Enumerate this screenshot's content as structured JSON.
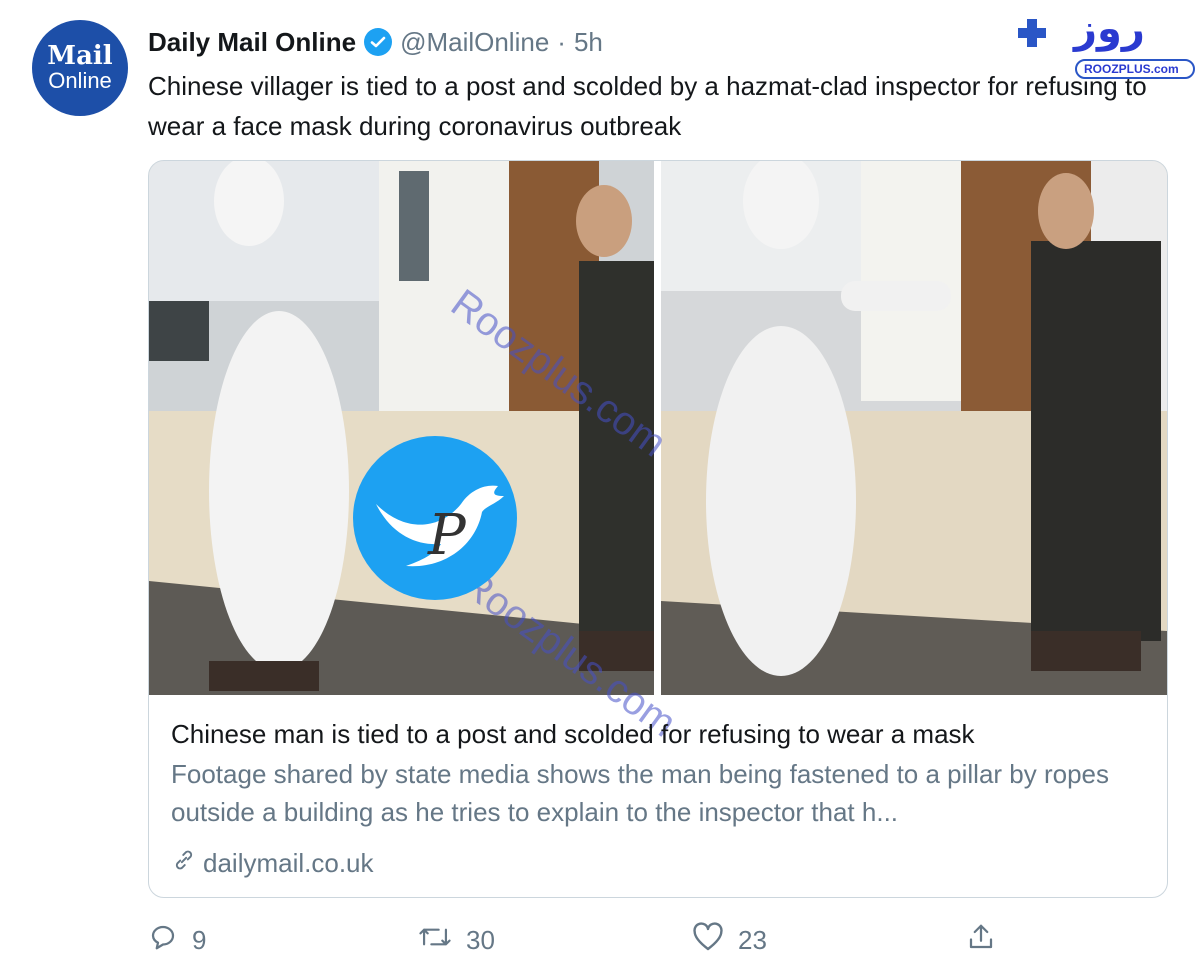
{
  "account": {
    "avatar_line1": "Mail",
    "avatar_line2": "Online",
    "name": "Daily Mail Online",
    "handle": "@MailOnline",
    "separator": "·",
    "time": "5h"
  },
  "tweet": {
    "text": "Chinese villager is tied to a post and scolded by a hazmat-clad inspector for refusing to wear a face mask during coronavirus outbreak"
  },
  "card": {
    "title": "Chinese man is tied to a post and scolded for refusing to wear a mask",
    "description": "Footage shared by state media shows the man being fastened to a pillar by ropes outside a building as he tries to explain to the inspector that h...",
    "domain": "dailymail.co.uk"
  },
  "actions": {
    "reply_count": "9",
    "retweet_count": "30",
    "like_count": "23"
  },
  "watermarks": {
    "corner_brand": "ROOZPLUS.com",
    "corner_text": "روز",
    "overlay_text_1": "Roozplus.com",
    "overlay_text_2": "Roozplus.com",
    "center_logo_letter": "P"
  },
  "icons": {
    "verified": "verified-badge-icon",
    "link": "link-icon",
    "reply": "reply-icon",
    "retweet": "retweet-icon",
    "like": "heart-icon",
    "share": "share-icon"
  },
  "colors": {
    "twitter_blue": "#1da1f2",
    "mail_blue": "#1d4fa8",
    "muted_text": "#657786"
  }
}
